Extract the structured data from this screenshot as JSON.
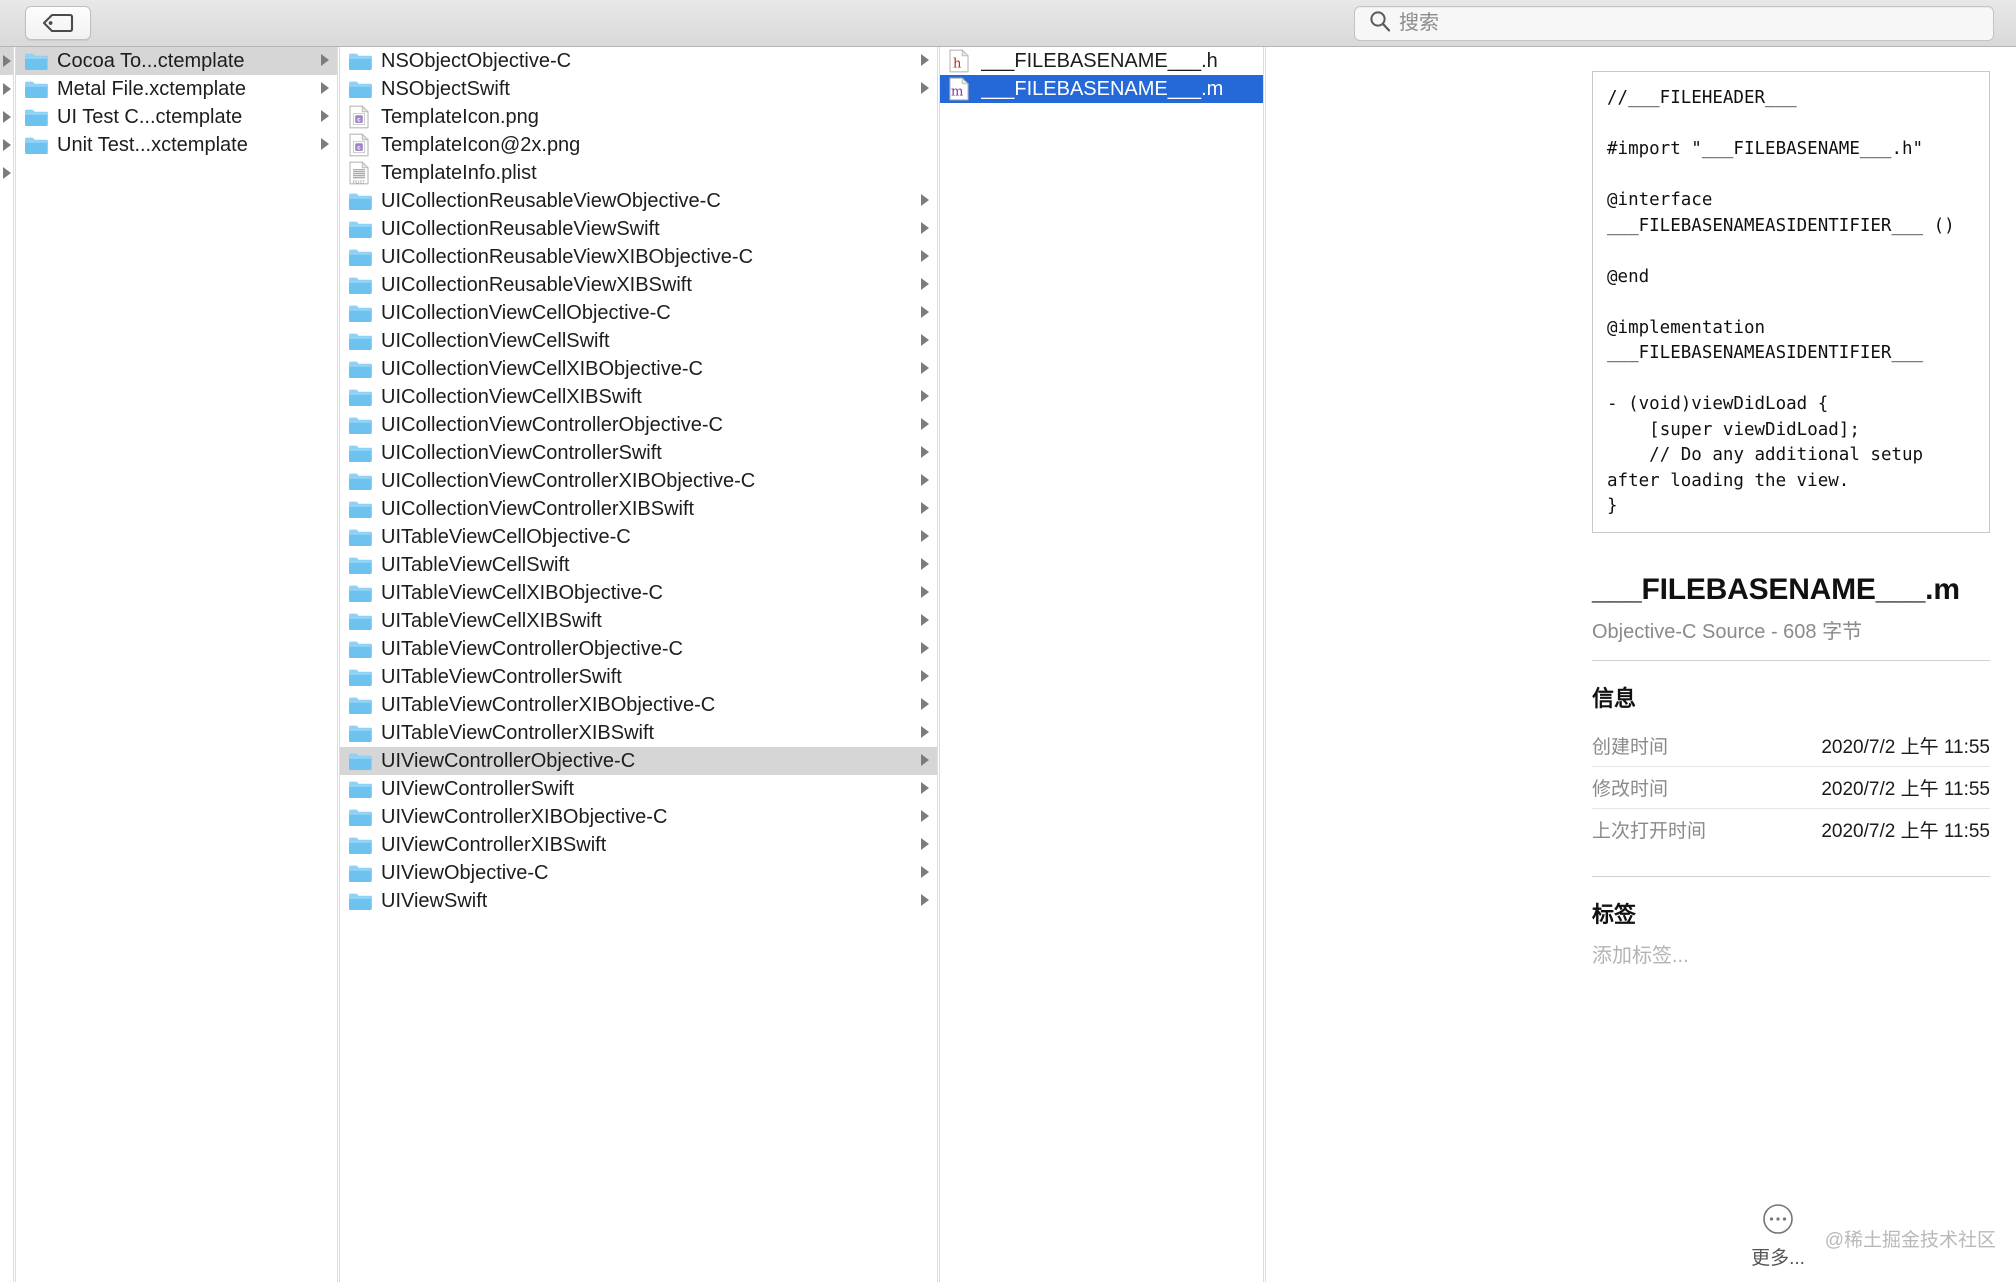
{
  "toolbar": {
    "tag_button_icon": "tag-icon",
    "search": {
      "icon": "search-icon",
      "placeholder": "搜索",
      "value": ""
    }
  },
  "columns": {
    "col1": {
      "items": [
        {
          "label": "Cocoa To...ctemplate",
          "icon": "folder-icon",
          "disclosure": true,
          "selected": true
        },
        {
          "label": "Metal File.xctemplate",
          "icon": "folder-icon",
          "disclosure": true,
          "selected": false
        },
        {
          "label": "UI Test C...ctemplate",
          "icon": "folder-icon",
          "disclosure": true,
          "selected": false
        },
        {
          "label": "Unit Test...xctemplate",
          "icon": "folder-icon",
          "disclosure": true,
          "selected": false
        }
      ]
    },
    "col2": {
      "items": [
        {
          "label": "NSObjectObjective-C",
          "icon": "folder-icon",
          "disclosure": true,
          "selected": false
        },
        {
          "label": "NSObjectSwift",
          "icon": "folder-icon",
          "disclosure": true,
          "selected": false
        },
        {
          "label": "TemplateIcon.png",
          "icon": "image-c-file-icon",
          "disclosure": false,
          "selected": false
        },
        {
          "label": "TemplateIcon@2x.png",
          "icon": "image-c-file-icon",
          "disclosure": false,
          "selected": false
        },
        {
          "label": "TemplateInfo.plist",
          "icon": "plist-file-icon",
          "disclosure": false,
          "selected": false
        },
        {
          "label": "UICollectionReusableViewObjective-C",
          "icon": "folder-icon",
          "disclosure": true,
          "selected": false
        },
        {
          "label": "UICollectionReusableViewSwift",
          "icon": "folder-icon",
          "disclosure": true,
          "selected": false
        },
        {
          "label": "UICollectionReusableViewXIBObjective-C",
          "icon": "folder-icon",
          "disclosure": true,
          "selected": false
        },
        {
          "label": "UICollectionReusableViewXIBSwift",
          "icon": "folder-icon",
          "disclosure": true,
          "selected": false
        },
        {
          "label": "UICollectionViewCellObjective-C",
          "icon": "folder-icon",
          "disclosure": true,
          "selected": false
        },
        {
          "label": "UICollectionViewCellSwift",
          "icon": "folder-icon",
          "disclosure": true,
          "selected": false
        },
        {
          "label": "UICollectionViewCellXIBObjective-C",
          "icon": "folder-icon",
          "disclosure": true,
          "selected": false
        },
        {
          "label": "UICollectionViewCellXIBSwift",
          "icon": "folder-icon",
          "disclosure": true,
          "selected": false
        },
        {
          "label": "UICollectionViewControllerObjective-C",
          "icon": "folder-icon",
          "disclosure": true,
          "selected": false
        },
        {
          "label": "UICollectionViewControllerSwift",
          "icon": "folder-icon",
          "disclosure": true,
          "selected": false
        },
        {
          "label": "UICollectionViewControllerXIBObjective-C",
          "icon": "folder-icon",
          "disclosure": true,
          "selected": false
        },
        {
          "label": "UICollectionViewControllerXIBSwift",
          "icon": "folder-icon",
          "disclosure": true,
          "selected": false
        },
        {
          "label": "UITableViewCellObjective-C",
          "icon": "folder-icon",
          "disclosure": true,
          "selected": false
        },
        {
          "label": "UITableViewCellSwift",
          "icon": "folder-icon",
          "disclosure": true,
          "selected": false
        },
        {
          "label": "UITableViewCellXIBObjective-C",
          "icon": "folder-icon",
          "disclosure": true,
          "selected": false
        },
        {
          "label": "UITableViewCellXIBSwift",
          "icon": "folder-icon",
          "disclosure": true,
          "selected": false
        },
        {
          "label": "UITableViewControllerObjective-C",
          "icon": "folder-icon",
          "disclosure": true,
          "selected": false
        },
        {
          "label": "UITableViewControllerSwift",
          "icon": "folder-icon",
          "disclosure": true,
          "selected": false
        },
        {
          "label": "UITableViewControllerXIBObjective-C",
          "icon": "folder-icon",
          "disclosure": true,
          "selected": false
        },
        {
          "label": "UITableViewControllerXIBSwift",
          "icon": "folder-icon",
          "disclosure": true,
          "selected": false
        },
        {
          "label": "UIViewControllerObjective-C",
          "icon": "folder-icon",
          "disclosure": true,
          "selected": true
        },
        {
          "label": "UIViewControllerSwift",
          "icon": "folder-icon",
          "disclosure": true,
          "selected": false
        },
        {
          "label": "UIViewControllerXIBObjective-C",
          "icon": "folder-icon",
          "disclosure": true,
          "selected": false
        },
        {
          "label": "UIViewControllerXIBSwift",
          "icon": "folder-icon",
          "disclosure": true,
          "selected": false
        },
        {
          "label": "UIViewObjective-C",
          "icon": "folder-icon",
          "disclosure": true,
          "selected": false
        },
        {
          "label": "UIViewSwift",
          "icon": "folder-icon",
          "disclosure": true,
          "selected": false
        }
      ]
    },
    "col3": {
      "items": [
        {
          "label": "___FILEBASENAME___.h",
          "icon": "h-source-file-icon",
          "disclosure": false,
          "selected": false
        },
        {
          "label": "___FILEBASENAME___.m",
          "icon": "m-source-file-icon",
          "disclosure": false,
          "selected": true
        }
      ]
    }
  },
  "inspector": {
    "preview_code": "//___FILEHEADER___\n\n#import \"___FILEBASENAME___.h\"\n\n@interface ___FILEBASENAMEASIDENTIFIER___ ()\n\n@end\n\n@implementation ___FILEBASENAMEASIDENTIFIER___\n\n- (void)viewDidLoad {\n    [super viewDidLoad];\n    // Do any additional setup after loading the view.\n}",
    "file_name": "___FILEBASENAME___.m",
    "file_kind_size": "Objective-C Source - 608 字节",
    "info_section_title": "信息",
    "info_rows": [
      {
        "key": "创建时间",
        "value": "2020/7/2 上午 11:55"
      },
      {
        "key": "修改时间",
        "value": "2020/7/2 上午 11:55"
      },
      {
        "key": "上次打开时间",
        "value": "2020/7/2 上午 11:55"
      }
    ],
    "tags_section_title": "标签",
    "tags_placeholder": "添加标签...",
    "more_label": "更多...",
    "more_icon": "ellipsis-circle-icon",
    "watermark": "@稀土掘金技术社区"
  },
  "colors": {
    "selection_active": "#2568d8",
    "selection_inactive": "#d6d6d6",
    "folder_blue": "#6ec4f2",
    "toolbar_bg": "#e0e0e0"
  }
}
